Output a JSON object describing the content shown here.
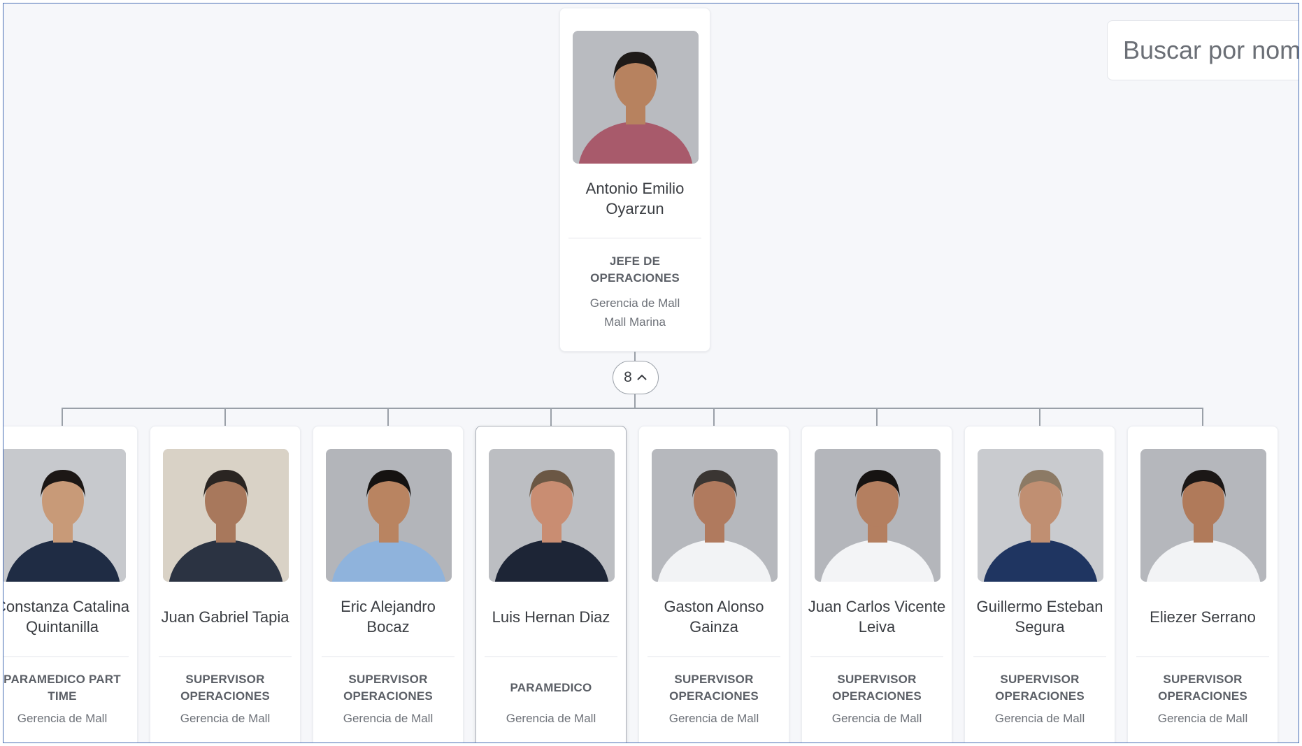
{
  "search": {
    "placeholder": "Buscar por nombre"
  },
  "root": {
    "name_lines": [
      "Antonio Emilio",
      "Oyarzun"
    ],
    "role": "JEFE DE\nOPERACIONES",
    "dept": "Gerencia de Mall\nMall Marina",
    "photo": {
      "bg": "#b9bbc0",
      "shirt": "#a85a6b",
      "skin": "#b7825f",
      "hair": "#1e1a18"
    }
  },
  "toggle": {
    "count": "8",
    "icon": "chevron-up-icon"
  },
  "children": [
    {
      "name_lines": [
        "Constanza Catalina",
        "Quintanilla"
      ],
      "role": "PARAMEDICO PART\nTIME",
      "dept": "Gerencia de Mall",
      "photo": {
        "bg": "#c7c9cd",
        "shirt": "#1f2c44",
        "skin": "#c89a78",
        "hair": "#1c1715"
      }
    },
    {
      "name_lines": [
        "Juan Gabriel Tapia"
      ],
      "role": "SUPERVISOR\nOPERACIONES",
      "dept": "Gerencia de Mall",
      "photo": {
        "bg": "#d9d2c6",
        "shirt": "#2b3342",
        "skin": "#a8785c",
        "hair": "#2a2522"
      }
    },
    {
      "name_lines": [
        "Eric Alejandro",
        "Bocaz"
      ],
      "role": "SUPERVISOR\nOPERACIONES",
      "dept": "Gerencia de Mall",
      "photo": {
        "bg": "#b3b5ba",
        "shirt": "#8fb3dc",
        "skin": "#b98461",
        "hair": "#151211"
      }
    },
    {
      "name_lines": [
        "Luis Hernan Diaz"
      ],
      "role": "PARAMEDICO",
      "dept": "Gerencia de Mall",
      "selected": true,
      "photo": {
        "bg": "#bcbec2",
        "shirt": "#1d2536",
        "skin": "#c98d72",
        "hair": "#6b5744"
      }
    },
    {
      "name_lines": [
        "Gaston Alonso",
        "Gainza"
      ],
      "role": "SUPERVISOR\nOPERACIONES",
      "dept": "Gerencia de Mall",
      "photo": {
        "bg": "#b6b8bd",
        "shirt": "#f2f3f5",
        "skin": "#b07a5e",
        "hair": "#3a3532"
      }
    },
    {
      "name_lines": [
        "Juan Carlos Vicente",
        "Leiva"
      ],
      "role": "SUPERVISOR\nOPERACIONES",
      "dept": "Gerencia de Mall",
      "photo": {
        "bg": "#b4b6bb",
        "shirt": "#f3f4f6",
        "skin": "#b47f60",
        "hair": "#161312"
      }
    },
    {
      "name_lines": [
        "Guillermo Esteban",
        "Segura"
      ],
      "role": "SUPERVISOR\nOPERACIONES",
      "dept": "Gerencia de Mall",
      "photo": {
        "bg": "#c9cbcf",
        "shirt": "#1f3561",
        "skin": "#c08f72",
        "hair": "#8c7a65"
      }
    },
    {
      "name_lines": [
        "Eliezer Serrano"
      ],
      "role": "SUPERVISOR\nOPERACIONES",
      "dept": "Gerencia de Mall",
      "photo": {
        "bg": "#b5b7bc",
        "shirt": "#f2f3f5",
        "skin": "#b07a5a",
        "hair": "#1b1716"
      }
    }
  ]
}
